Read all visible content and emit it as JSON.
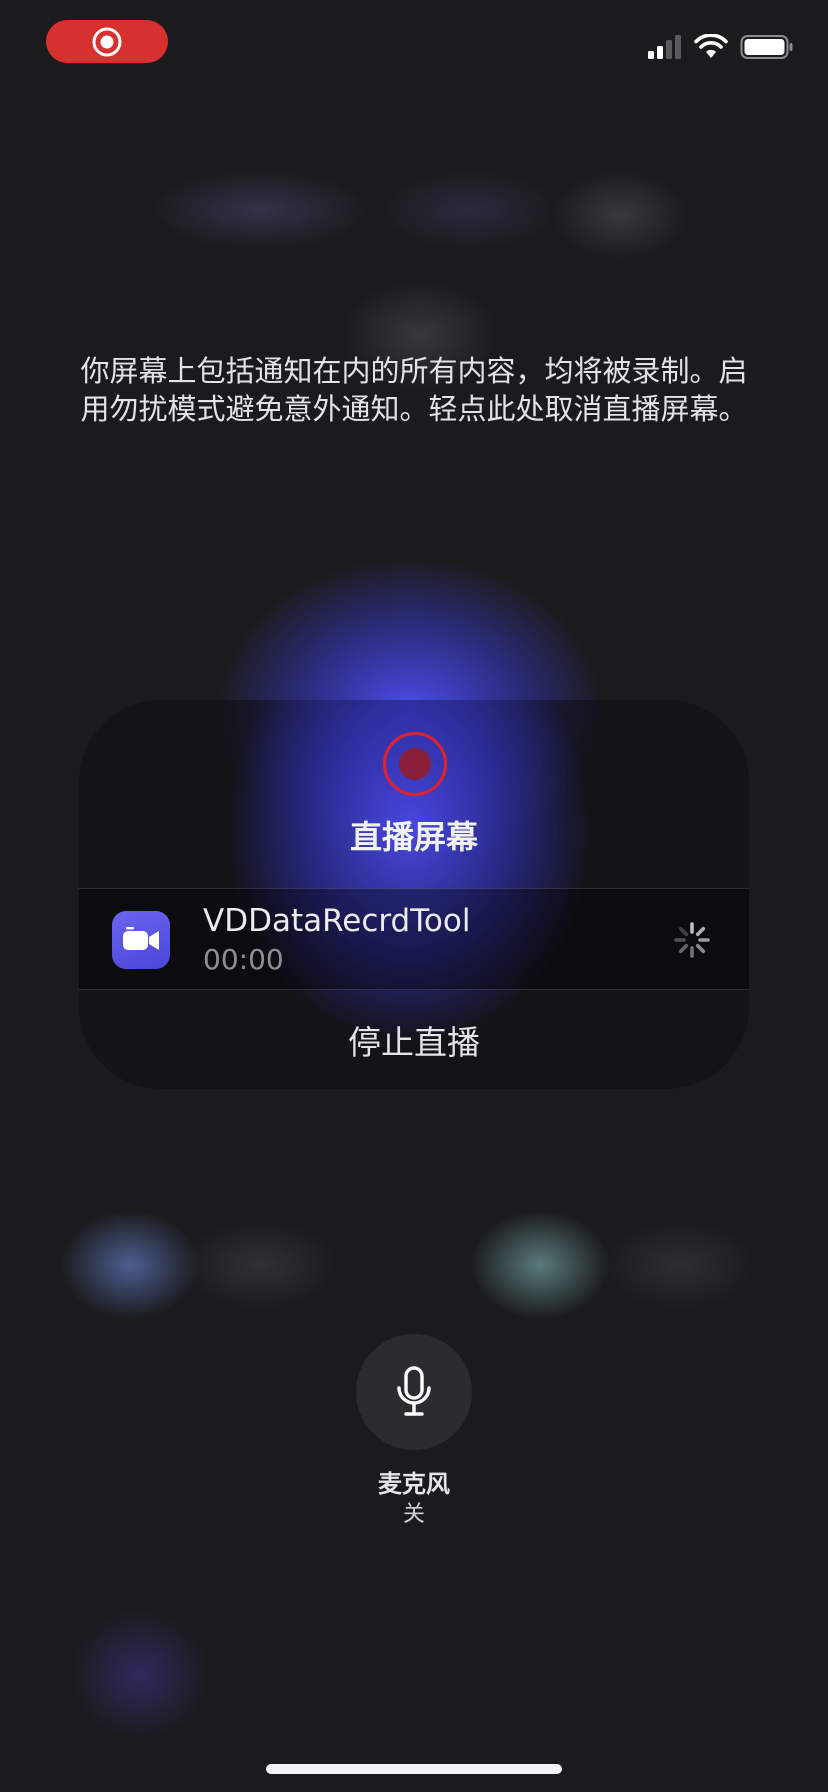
{
  "status_bar": {
    "recording_indicator_icon": "record-icon",
    "signal_icon": "cellular-signal-icon",
    "wifi_icon": "wifi-icon",
    "battery_icon": "battery-icon"
  },
  "notice": {
    "text": "你屏幕上包括通知在内的所有内容，均将被录制。启用勿扰模式避免意外通知。轻点此处取消直播屏幕。"
  },
  "broadcast_card": {
    "title": "直播屏幕",
    "app": {
      "name": "VDDataRecrdTool",
      "elapsed": "00:00",
      "icon": "video-camera-icon"
    },
    "stop_label": "停止直播"
  },
  "microphone": {
    "label": "麦克风",
    "state": "关"
  },
  "colors": {
    "record_red": "#d6312f",
    "app_icon": "#5a54e6",
    "background": "#1b1b1e"
  }
}
